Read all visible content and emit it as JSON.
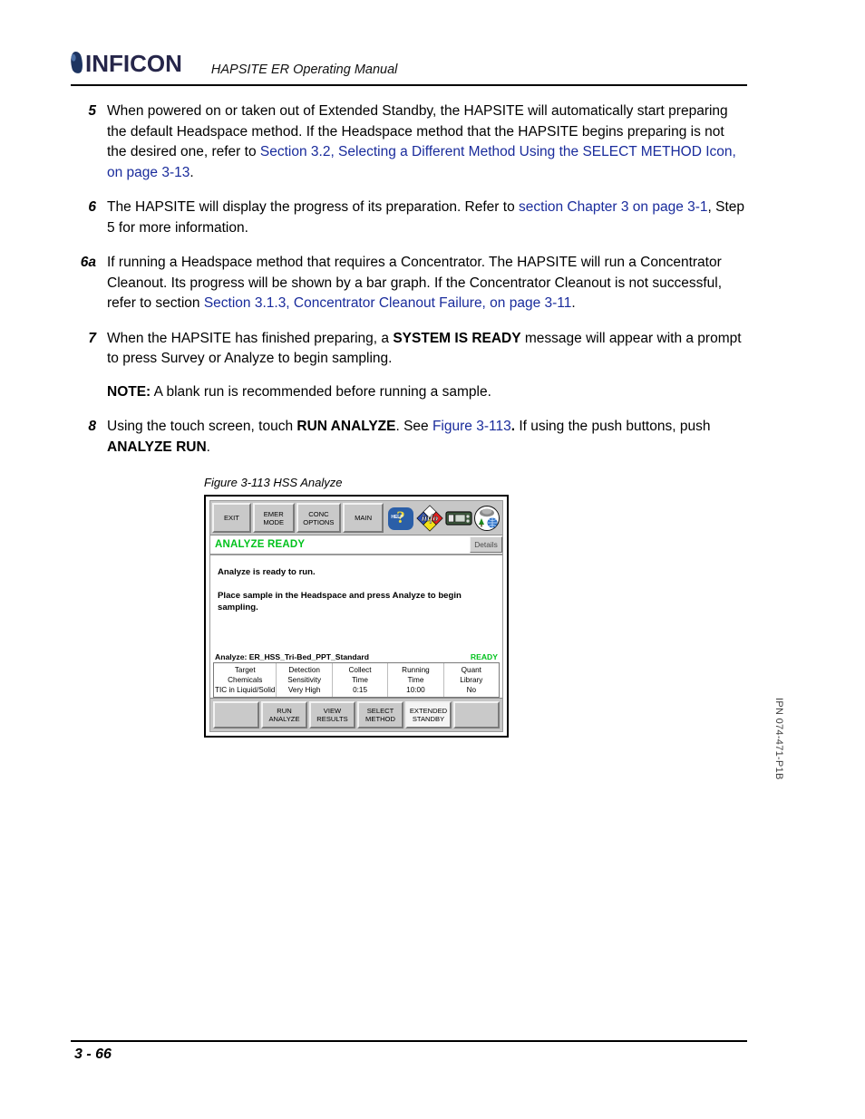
{
  "header": {
    "logo_text": "INFICON",
    "title": "HAPSITE ER Operating Manual"
  },
  "steps": [
    {
      "num": "5",
      "segments": [
        {
          "text": "When powered on or taken out of Extended Standby, the HAPSITE will automatically start preparing the default Headspace method. If the Headspace method that the HAPSITE begins preparing is not the desired one, refer to ",
          "style": "plain"
        },
        {
          "text": "Section 3.2, Selecting a Different Method Using the SELECT METHOD Icon, on page 3-13",
          "style": "link"
        },
        {
          "text": ".",
          "style": "plain"
        }
      ]
    },
    {
      "num": "6",
      "segments": [
        {
          "text": "The HAPSITE will display the progress of its preparation. Refer to ",
          "style": "plain"
        },
        {
          "text": "section Chapter 3 on page 3-1",
          "style": "link"
        },
        {
          "text": ", Step 5 for more information.",
          "style": "plain"
        }
      ]
    },
    {
      "num": "6a",
      "segments": [
        {
          "text": "If running a Headspace method that requires a Concentrator. The HAPSITE will run a Concentrator Cleanout. Its progress will be shown by a bar graph. If the Concentrator Cleanout is not successful, refer to section ",
          "style": "plain"
        },
        {
          "text": "Section 3.1.3, Concentrator Cleanout Failure, on page 3-11",
          "style": "link"
        },
        {
          "text": ".",
          "style": "plain"
        }
      ]
    },
    {
      "num": "7",
      "segments": [
        {
          "text": "When the HAPSITE has finished preparing, a ",
          "style": "plain"
        },
        {
          "text": "SYSTEM IS READY",
          "style": "bold"
        },
        {
          "text": " message will appear with a prompt to press Survey or Analyze to begin sampling.",
          "style": "plain"
        }
      ],
      "note_label": "NOTE:",
      "note_text": "A blank run is recommended before running a sample."
    },
    {
      "num": "8",
      "segments": [
        {
          "text": "Using the touch screen, touch ",
          "style": "plain"
        },
        {
          "text": "RUN ANALYZE",
          "style": "bold"
        },
        {
          "text": ". See ",
          "style": "plain"
        },
        {
          "text": "Figure 3-113",
          "style": "link"
        },
        {
          "text": ".",
          "style": "bold"
        },
        {
          "text": " If using the push buttons, push ",
          "style": "plain"
        },
        {
          "text": "ANALYZE RUN",
          "style": "bold"
        },
        {
          "text": ".",
          "style": "plain"
        }
      ]
    }
  ],
  "figure": {
    "caption": "Figure 3-113  HSS Analyze",
    "toolbar": {
      "buttons": [
        {
          "line1": "EXIT",
          "line2": ""
        },
        {
          "line1": "EMER",
          "line2": "MODE"
        },
        {
          "line1": "CONC",
          "line2": "OPTIONS"
        },
        {
          "line1": "MAIN",
          "line2": ""
        }
      ],
      "icons": [
        {
          "name": "help-icon",
          "label": "HELP"
        },
        {
          "name": "info-diamond-icon",
          "label": "info"
        },
        {
          "name": "instrument-icon",
          "label": ""
        },
        {
          "name": "environment-icon",
          "label": ""
        }
      ]
    },
    "status": {
      "text": "ANALYZE READY",
      "color": "#00c21c",
      "details_label": "Details"
    },
    "messages": [
      "Analyze is ready to run.",
      "Place sample in the Headspace and press Analyze to begin sampling."
    ],
    "method": {
      "label": "Analyze: ER_HSS_Tri-Bed_PPT_Standard",
      "state": "READY",
      "columns": [
        {
          "h1": "Target",
          "h2": "Chemicals",
          "value": "TIC in Liquid/Solid"
        },
        {
          "h1": "Detection",
          "h2": "Sensitivity",
          "value": "Very High"
        },
        {
          "h1": "Collect",
          "h2": "Time",
          "value": "0:15"
        },
        {
          "h1": "Running",
          "h2": "Time",
          "value": "10:00"
        },
        {
          "h1": "Quant",
          "h2": "Library",
          "value": "No"
        }
      ]
    },
    "bottom_buttons": [
      {
        "line1": "",
        "line2": "",
        "light": false
      },
      {
        "line1": "RUN",
        "line2": "ANALYZE",
        "light": false
      },
      {
        "line1": "VIEW",
        "line2": "RESULTS",
        "light": false
      },
      {
        "line1": "SELECT",
        "line2": "METHOD",
        "light": false
      },
      {
        "line1": "EXTENDED",
        "line2": "STANDBY",
        "light": true
      },
      {
        "line1": "",
        "line2": "",
        "light": false
      }
    ]
  },
  "footer": {
    "page_number": "3 - 66",
    "ipn": "IPN 074-471-P1B"
  }
}
